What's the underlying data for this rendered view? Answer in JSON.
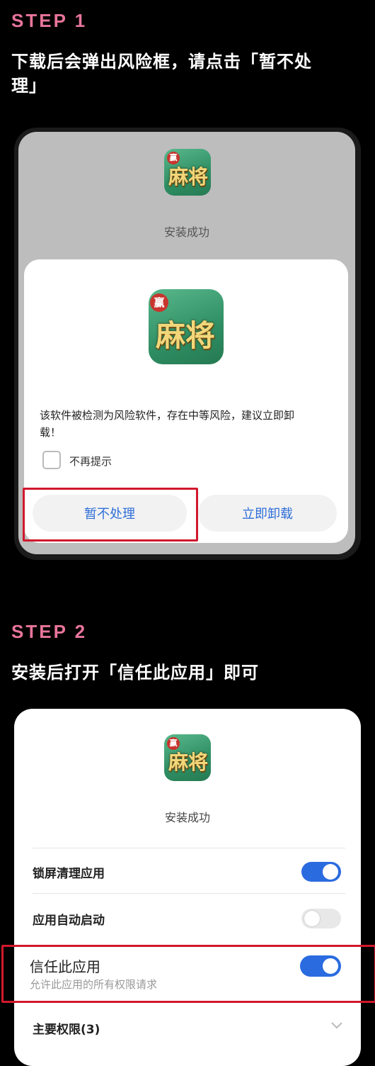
{
  "step1": {
    "title": "STEP 1",
    "instruction_line1": "下载后会弹出风险框，请点击「暂不处",
    "instruction_line2": "理」",
    "screen": {
      "icon_badge": "赢",
      "icon_text": "麻将",
      "install_status": "安装成功",
      "dialog": {
        "message_line1": "该软件被检测为风险软件，存在中等风险，建议立即卸",
        "message_line2": "载！",
        "checkbox_label": "不再提示",
        "checkbox_checked": false,
        "ignore_button": "暂不处理",
        "uninstall_button": "立即卸载",
        "accent_color": "#2f6fd8"
      }
    }
  },
  "step2": {
    "title": "STEP 2",
    "instruction": "安装后打开「信任此应用」即可",
    "screen": {
      "icon_badge": "赢",
      "icon_text": "麻将",
      "install_status": "安装成功",
      "settings": [
        {
          "label": "锁屏清理应用",
          "enabled": true
        },
        {
          "label": "应用自动启动",
          "enabled": false
        },
        {
          "label": "信任此应用",
          "subtitle": "允许此应用的所有权限请求",
          "enabled": true
        }
      ],
      "permissions_label": "主要权限(3)",
      "toggle_on_color": "#2a6be0"
    }
  },
  "highlight_color": "#d1182d",
  "step_title_color": "#e8759a"
}
